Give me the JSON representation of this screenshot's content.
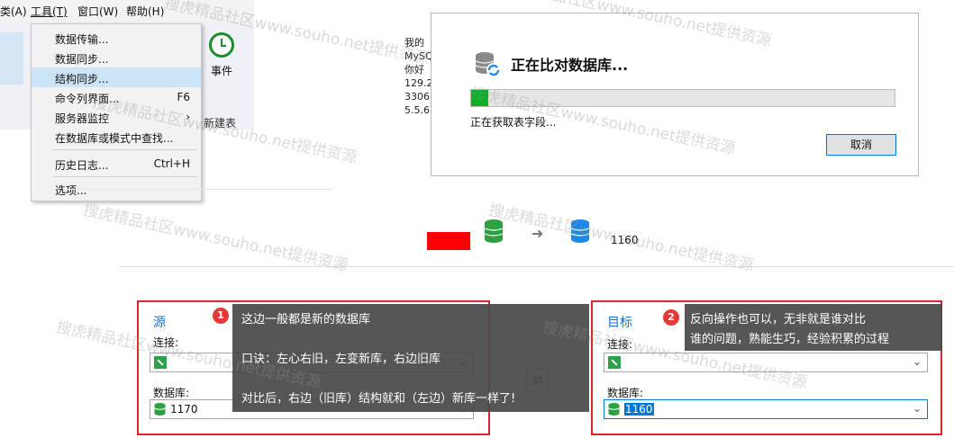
{
  "menubar": {
    "items": [
      "类(A)",
      "工具(T)",
      "窗口(W)",
      "帮助(H)"
    ]
  },
  "ribbon": {
    "event_label": "事件",
    "new_table_label": "新建表"
  },
  "tools_menu": {
    "items": [
      {
        "label": "数据传输...",
        "shortcut": ""
      },
      {
        "label": "数据同步...",
        "shortcut": ""
      },
      {
        "label": "结构同步...",
        "shortcut": ""
      },
      {
        "label": "命令列界面...",
        "shortcut": "F6"
      },
      {
        "label": "服务器监控",
        "shortcut": "›"
      },
      {
        "label": "在数据库或模式中查找...",
        "shortcut": ""
      },
      {
        "label": "历史日志...",
        "shortcut": "Ctrl+H"
      },
      {
        "label": "选项...",
        "shortcut": ""
      }
    ],
    "selected_index": 2
  },
  "background_text": [
    "我的",
    "MySQ",
    "你好",
    "129.2",
    "3306",
    "5.5.6"
  ],
  "compare_dialog": {
    "title": "正在比对数据库...",
    "progress": 0.04,
    "status": "正在获取表字段...",
    "cancel_label": "取消"
  },
  "sync_row": {
    "target_count": "1160"
  },
  "source_panel": {
    "heading": "源",
    "connection_label": "连接:",
    "connection_value": "",
    "database_label": "数据库:",
    "database_value": "1170"
  },
  "target_panel": {
    "heading": "目标",
    "connection_label": "连接:",
    "connection_value": "",
    "database_label": "数据库:",
    "database_value": "1160"
  },
  "callout1": {
    "number": "1",
    "line1": "这边一般都是新的数据库",
    "line2": "口诀：左心右旧，左变新库，右边旧库",
    "line3": "对比后，右边（旧库）结构就和（左边）新库一样了!"
  },
  "callout2": {
    "number": "2",
    "line1": "反向操作也可以，无非就是谁对比",
    "line2": "谁的问题，熟能生巧，经验积累的过程"
  },
  "watermark": "搜虎精品社区www.souho.net提供资源",
  "colors": {
    "accent": "#0078d7",
    "progress": "#06b025",
    "frame_red": "#d9252b",
    "heading_blue": "#1e6fc8"
  }
}
